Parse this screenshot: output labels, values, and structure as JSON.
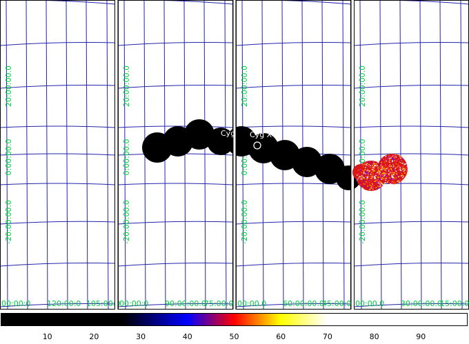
{
  "panels": [
    {
      "ra_labels": [
        "00:00:0",
        "120:00:0",
        "105:00:0"
      ],
      "dec_labels": [
        "20:00:00.0",
        "0:00:00.0",
        "-20:00:00.0"
      ]
    },
    {
      "ra_labels": [
        "00:00:0",
        "90:00:00.0",
        "75:00:0"
      ],
      "dec_labels": [
        "20:00:00.0",
        "0:00:00.0",
        "-20:00:00.0"
      ]
    },
    {
      "ra_labels": [
        "00:00.0",
        "60:00:00.0",
        "45:00:0"
      ],
      "dec_labels": [
        "20:00:00.0",
        "0:00:00.0",
        "-20:00:00.0"
      ]
    },
    {
      "ra_labels": [
        "00:00.0",
        "30:00:00.0",
        "15:00:0"
      ],
      "dec_labels": [
        "20:00:00.0",
        "0:00:00.0",
        "-20:00:00.0"
      ]
    }
  ],
  "source_labels": [
    "Cyg",
    "Cyg X-1"
  ],
  "colorbar": {
    "ticks": [
      "10",
      "20",
      "30",
      "40",
      "50",
      "60",
      "70",
      "80",
      "90"
    ],
    "range": [
      0,
      100
    ],
    "stops": [
      "#000000",
      "#000000",
      "#0000ff",
      "#ff0000",
      "#ffff00",
      "#ffffff",
      "#ffffff"
    ]
  },
  "colors": {
    "grid": "#2222aa",
    "label": "#00cc44",
    "border": "#000000"
  }
}
